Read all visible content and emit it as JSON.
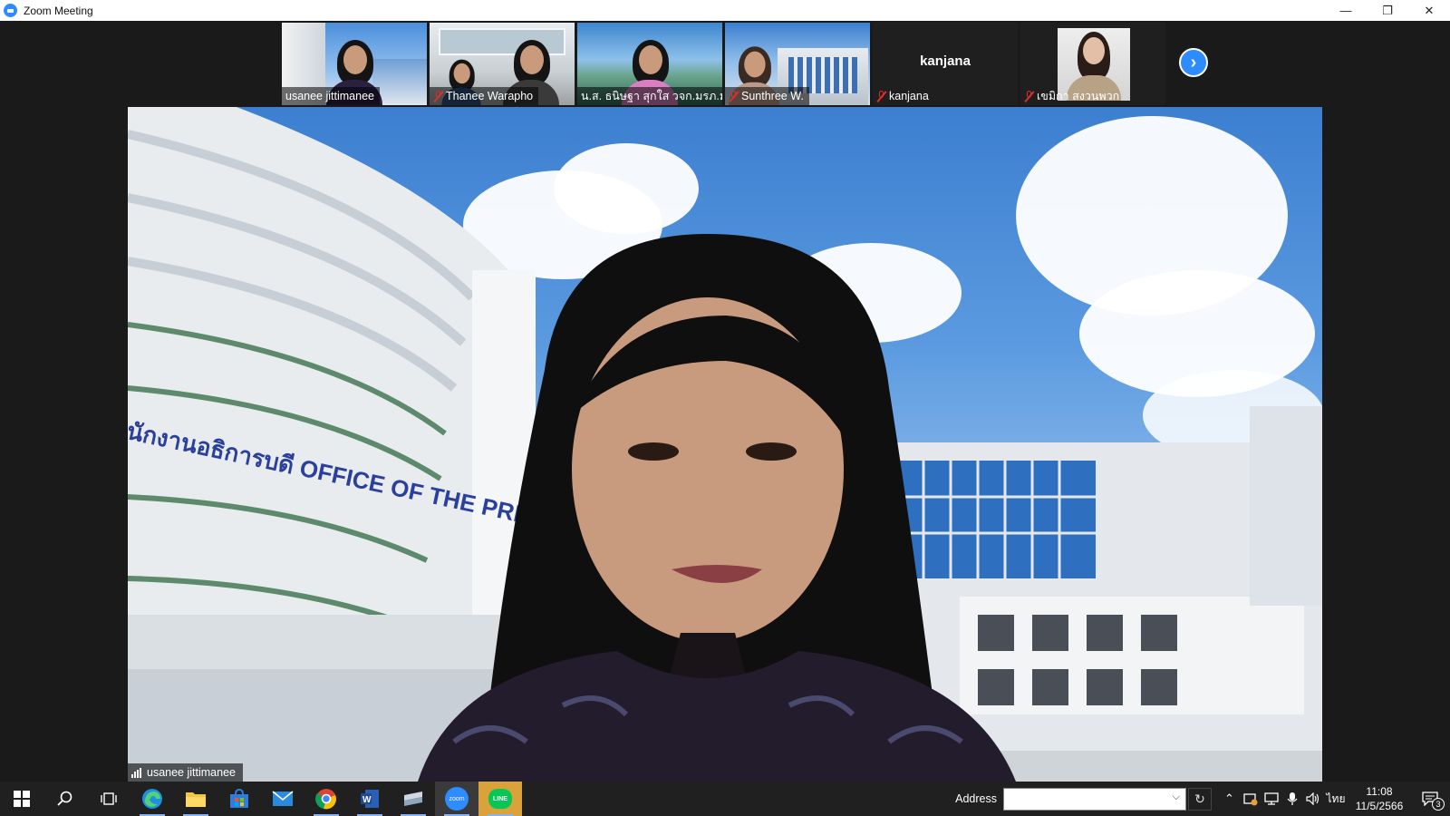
{
  "window": {
    "title": "Zoom Meeting",
    "controls": {
      "minimize": "—",
      "restore": "❐",
      "close": "✕"
    }
  },
  "gallery": {
    "participants": [
      {
        "name": "usanee jittimanee",
        "muted": false,
        "active": true
      },
      {
        "name": "Thanee Warapho",
        "muted": true,
        "active": false
      },
      {
        "name": "น.ส. ธนิษฐา สุกใส วจก.มรภ.ม...",
        "muted": true,
        "active": false
      },
      {
        "name": "Sunthree W.",
        "muted": true,
        "active": false
      },
      {
        "name": "kanjana",
        "muted": true,
        "active": false,
        "video_off": true,
        "center_label": "kanjana"
      },
      {
        "name": "เขมิกา สงวนพวก",
        "muted": true,
        "active": false
      }
    ],
    "next_page_icon": "chevron-right-icon"
  },
  "main_video": {
    "speaker_name": "usanee jittimanee",
    "connection_icon": "signal-bars-icon",
    "background_sign": "นักงานอธิการบดี OFFICE OF THE PRESIDENT"
  },
  "taskbar": {
    "apps": [
      {
        "name": "start",
        "icon": "windows-icon"
      },
      {
        "name": "search",
        "icon": "search-icon"
      },
      {
        "name": "task-view",
        "icon": "task-view-icon"
      },
      {
        "name": "edge",
        "icon": "edge-icon"
      },
      {
        "name": "file-explorer",
        "icon": "folder-icon"
      },
      {
        "name": "store",
        "icon": "store-icon"
      },
      {
        "name": "mail",
        "icon": "mail-icon"
      },
      {
        "name": "chrome",
        "icon": "chrome-icon"
      },
      {
        "name": "word",
        "icon": "word-icon"
      },
      {
        "name": "sublime",
        "icon": "editor-icon"
      },
      {
        "name": "zoom",
        "icon": "zoom-icon"
      },
      {
        "name": "line",
        "icon": "line-icon"
      }
    ],
    "zoom_label": "zoom",
    "line_label": "LINE",
    "address_label": "Address",
    "address_value": "",
    "language": "ไทย",
    "time": "11:08",
    "date": "11/5/2566",
    "notification_count": "3"
  }
}
